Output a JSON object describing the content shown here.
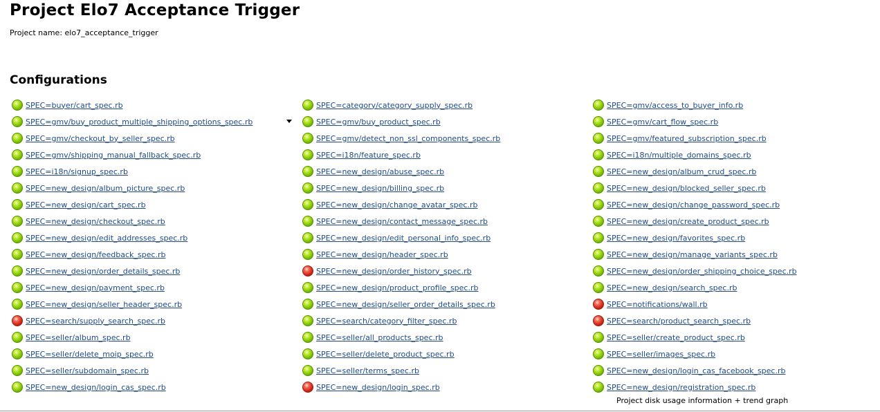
{
  "page": {
    "title": "Project Elo7 Acceptance Trigger",
    "project_name_text": "Project name: elo7_acceptance_trigger"
  },
  "configurations": {
    "title": "Configurations",
    "columns": [
      [
        {
          "label": "SPEC=buyer/cart_spec.rb",
          "status": "blue"
        },
        {
          "label": "SPEC=gmv/buy_product_multiple_shipping_options_spec.rb",
          "status": "blue"
        },
        {
          "label": "SPEC=gmv/checkout_by_seller_spec.rb",
          "status": "blue"
        },
        {
          "label": "SPEC=gmv/shipping_manual_fallback_spec.rb",
          "status": "blue"
        },
        {
          "label": "SPEC=i18n/signup_spec.rb",
          "status": "blue"
        },
        {
          "label": "SPEC=new_design/album_picture_spec.rb",
          "status": "blue"
        },
        {
          "label": "SPEC=new_design/cart_spec.rb",
          "status": "blue"
        },
        {
          "label": "SPEC=new_design/checkout_spec.rb",
          "status": "blue"
        },
        {
          "label": "SPEC=new_design/edit_addresses_spec.rb",
          "status": "blue"
        },
        {
          "label": "SPEC=new_design/feedback_spec.rb",
          "status": "blue"
        },
        {
          "label": "SPEC=new_design/order_details_spec.rb",
          "status": "blue"
        },
        {
          "label": "SPEC=new_design/payment_spec.rb",
          "status": "blue"
        },
        {
          "label": "SPEC=new_design/seller_header_spec.rb",
          "status": "blue"
        },
        {
          "label": "SPEC=search/supply_search_spec.rb",
          "status": "red"
        },
        {
          "label": "SPEC=seller/album_spec.rb",
          "status": "blue"
        },
        {
          "label": "SPEC=seller/delete_moip_spec.rb",
          "status": "blue"
        },
        {
          "label": "SPEC=seller/subdomain_spec.rb",
          "status": "blue"
        },
        {
          "label": "SPEC=new_design/login_cas_spec.rb",
          "status": "blue"
        }
      ],
      [
        {
          "label": "SPEC=category/category_supply_spec.rb",
          "status": "blue"
        },
        {
          "label": "SPEC=gmv/buy_product_spec.rb",
          "status": "blue"
        },
        {
          "label": "SPEC=gmv/detect_non_ssl_components_spec.rb",
          "status": "blue"
        },
        {
          "label": "SPEC=i18n/feature_spec.rb",
          "status": "blue"
        },
        {
          "label": "SPEC=new_design/abuse_spec.rb",
          "status": "blue"
        },
        {
          "label": "SPEC=new_design/billing_spec.rb",
          "status": "blue"
        },
        {
          "label": "SPEC=new_design/change_avatar_spec.rb",
          "status": "blue"
        },
        {
          "label": "SPEC=new_design/contact_message_spec.rb",
          "status": "blue"
        },
        {
          "label": "SPEC=new_design/edit_personal_info_spec.rb",
          "status": "blue"
        },
        {
          "label": "SPEC=new_design/header_spec.rb",
          "status": "blue"
        },
        {
          "label": "SPEC=new_design/order_history_spec.rb",
          "status": "red"
        },
        {
          "label": "SPEC=new_design/product_profile_spec.rb",
          "status": "blue"
        },
        {
          "label": "SPEC=new_design/seller_order_details_spec.rb",
          "status": "blue"
        },
        {
          "label": "SPEC=search/category_filter_spec.rb",
          "status": "blue"
        },
        {
          "label": "SPEC=seller/all_products_spec.rb",
          "status": "blue"
        },
        {
          "label": "SPEC=seller/delete_product_spec.rb",
          "status": "blue"
        },
        {
          "label": "SPEC=seller/terms_spec.rb",
          "status": "blue"
        },
        {
          "label": "SPEC=new_design/login_spec.rb",
          "status": "red"
        }
      ],
      [
        {
          "label": "SPEC=gmv/access_to_buyer_info.rb",
          "status": "blue"
        },
        {
          "label": "SPEC=gmv/cart_flow_spec.rb",
          "status": "blue"
        },
        {
          "label": "SPEC=gmv/featured_subscription_spec.rb",
          "status": "blue"
        },
        {
          "label": "SPEC=i18n/multiple_domains_spec.rb",
          "status": "blue"
        },
        {
          "label": "SPEC=new_design/album_crud_spec.rb",
          "status": "blue"
        },
        {
          "label": "SPEC=new_design/blocked_seller_spec.rb",
          "status": "blue"
        },
        {
          "label": "SPEC=new_design/change_password_spec.rb",
          "status": "blue"
        },
        {
          "label": "SPEC=new_design/create_product_spec.rb",
          "status": "blue"
        },
        {
          "label": "SPEC=new_design/favorites_spec.rb",
          "status": "blue"
        },
        {
          "label": "SPEC=new_design/manage_variants_spec.rb",
          "status": "blue"
        },
        {
          "label": "SPEC=new_design/order_shipping_choice_spec.rb",
          "status": "blue"
        },
        {
          "label": "SPEC=new_design/search_spec.rb",
          "status": "blue"
        },
        {
          "label": "SPEC=notifications/wall.rb",
          "status": "red"
        },
        {
          "label": "SPEC=search/product_search_spec.rb",
          "status": "red"
        },
        {
          "label": "SPEC=seller/create_product_spec.rb",
          "status": "blue"
        },
        {
          "label": "SPEC=seller/images_spec.rb",
          "status": "blue"
        },
        {
          "label": "SPEC=new_design/login_cas_facebook_spec.rb",
          "status": "blue"
        },
        {
          "label": "SPEC=new_design/registration_spec.rb",
          "status": "blue"
        }
      ]
    ]
  },
  "footer": {
    "disk_usage_text": "Project disk usage information + trend graph"
  }
}
